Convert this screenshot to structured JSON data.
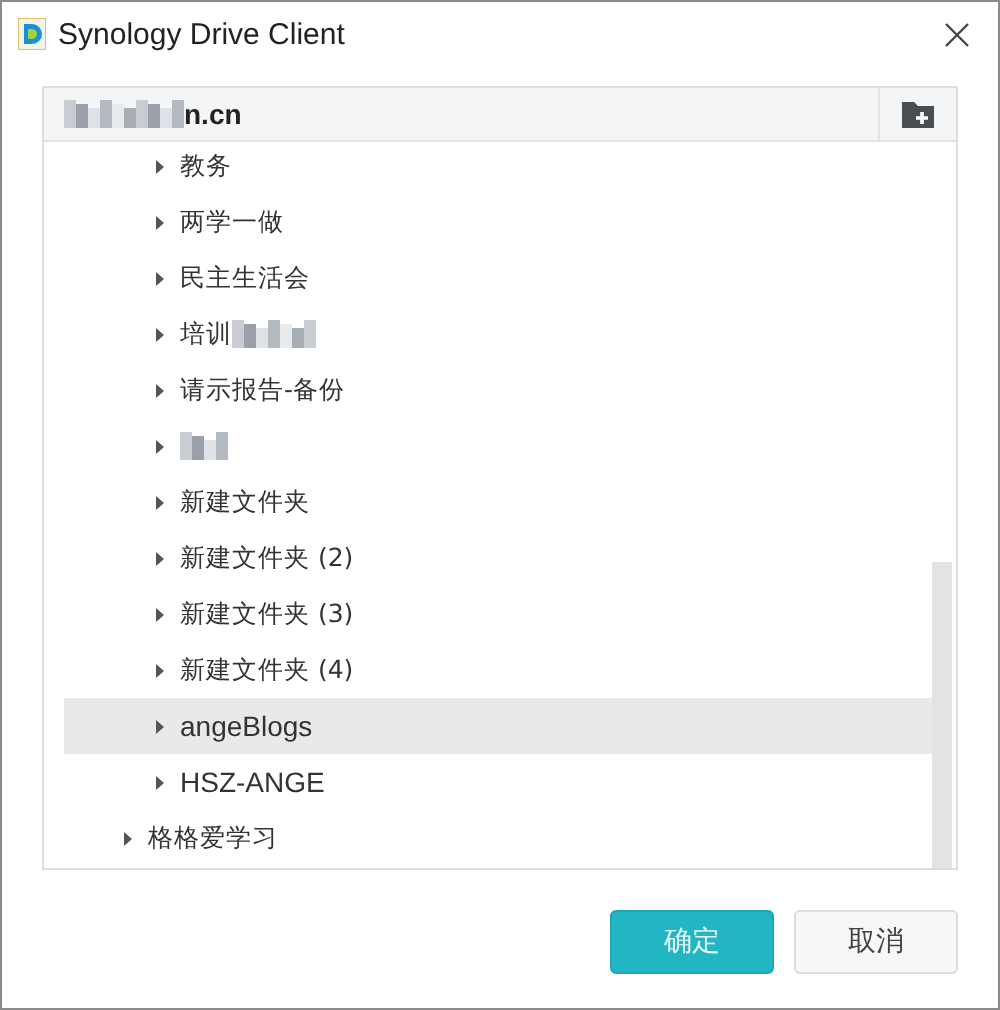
{
  "window": {
    "title": "Synology Drive Client"
  },
  "location": {
    "label": "n.cn",
    "redacted": true
  },
  "folders": [
    {
      "children": [
        {
          "label": "教务",
          "selected": false
        },
        {
          "label": "两学一做",
          "selected": false
        },
        {
          "label": "民主生活会",
          "selected": false
        },
        {
          "label": "培训",
          "redacted": true,
          "selected": false
        },
        {
          "label": "请示报告-备份",
          "selected": false
        },
        {
          "redacted": true,
          "selected": false
        },
        {
          "label": "新建文件夹",
          "selected": false
        },
        {
          "label": "新建文件夹 (2)",
          "selected": false
        },
        {
          "label": "新建文件夹 (3)",
          "selected": false
        },
        {
          "label": "新建文件夹 (4)",
          "selected": false
        },
        {
          "label": "angeBlogs",
          "selected": true
        },
        {
          "label": "HSZ-ANGE",
          "selected": false
        }
      ]
    },
    {
      "label": "格格爱学习",
      "selected": false
    }
  ],
  "buttons": [
    {
      "label": "确定",
      "kind": "primary"
    },
    {
      "label": "取消",
      "kind": "secondary"
    }
  ]
}
